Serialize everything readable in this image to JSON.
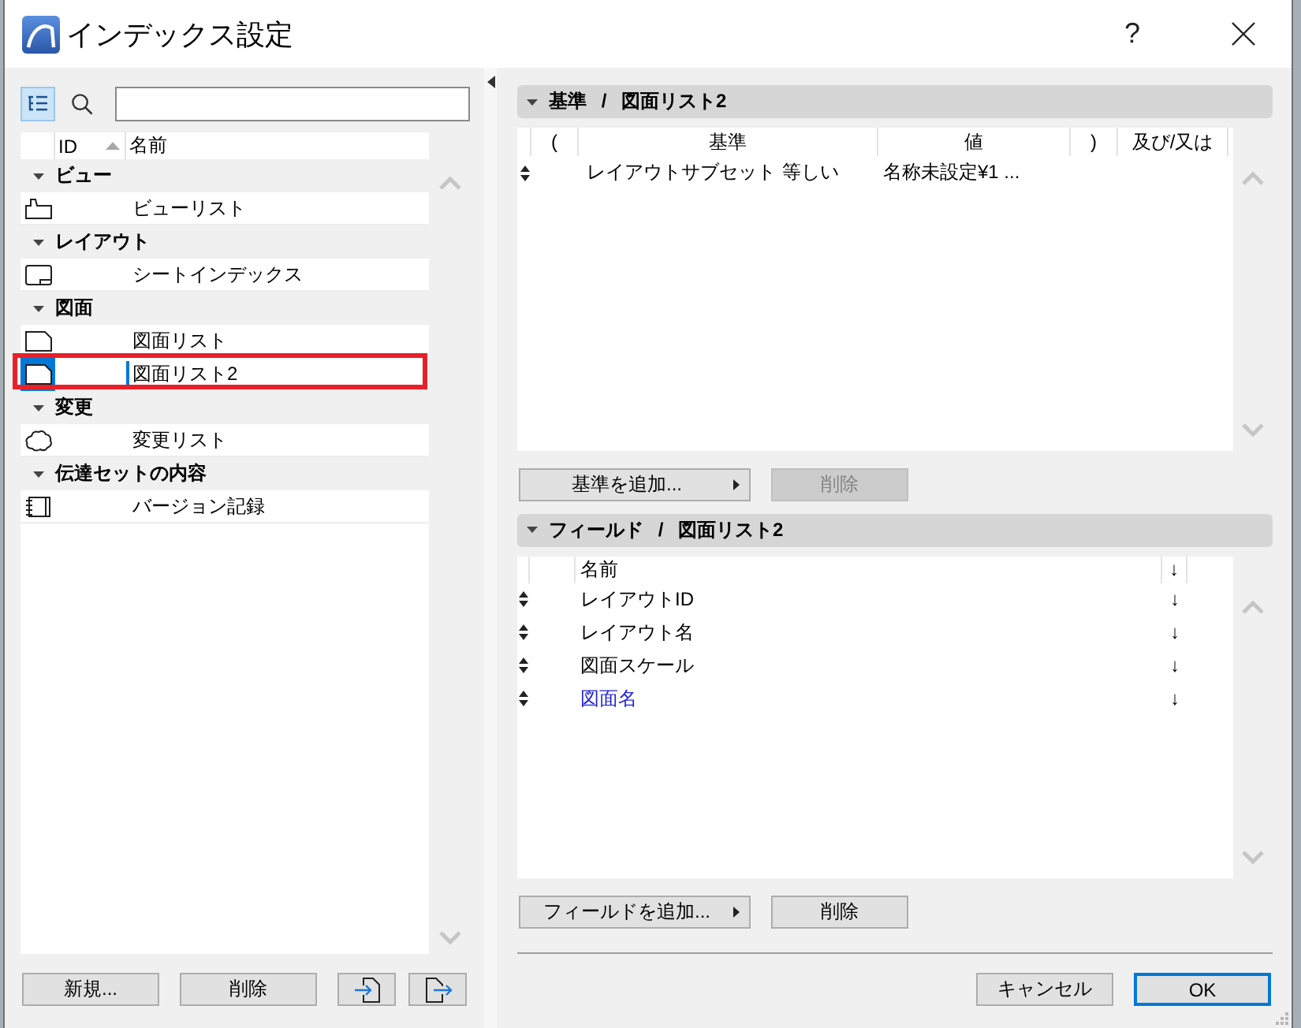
{
  "window": {
    "title": "インデックス設定",
    "help": "?"
  },
  "sidebar": {
    "list_view": {
      "selected": true
    },
    "columns": [
      {
        "label": "ID",
        "sorted": true
      },
      {
        "label": "名前",
        "sorted": false
      }
    ],
    "groups": [
      {
        "label": "ビュー",
        "expanded": true,
        "children": [
          {
            "name": "ビューリスト",
            "kind": "view",
            "selected": false,
            "marked": false
          }
        ]
      },
      {
        "label": "レイアウト",
        "expanded": true,
        "children": [
          {
            "name": "シートインデックス",
            "kind": "sheet",
            "selected": false,
            "marked": false
          }
        ]
      },
      {
        "label": "図面",
        "expanded": true,
        "children": [
          {
            "name": "図面リスト",
            "kind": "drawing",
            "selected": false,
            "marked": false
          },
          {
            "name": "図面リスト2",
            "kind": "drawing",
            "selected": true,
            "marked": true
          }
        ]
      },
      {
        "label": "変更",
        "expanded": true,
        "children": [
          {
            "name": "変更リスト",
            "kind": "change",
            "selected": false,
            "marked": false
          }
        ]
      },
      {
        "label": "伝達セットの内容",
        "expanded": true,
        "children": [
          {
            "name": "バージョン記録",
            "kind": "log",
            "selected": false,
            "marked": false
          }
        ]
      }
    ],
    "buttons": [
      {
        "kind": "text",
        "label": "新規..."
      },
      {
        "kind": "text",
        "label": "削除"
      },
      {
        "kind": "import"
      },
      {
        "kind": "export"
      }
    ]
  },
  "criteria": {
    "title": "基準 / 図面リスト2",
    "expanded": true,
    "columns": [
      "(",
      "基準",
      "値",
      ")",
      "及び/又は"
    ],
    "rows": [
      {
        "criterion": "レイアウトサブセット",
        "operator": "等しい",
        "value": "名称未設定¥1 ..."
      }
    ],
    "buttons": [
      {
        "kind": "menu",
        "label": "基準を追加...",
        "disabled": false
      },
      {
        "kind": "plain",
        "label": "削除",
        "disabled": true
      }
    ]
  },
  "fields": {
    "title": "フィールド / 図面リスト2",
    "expanded": true,
    "columns": [
      "名前",
      "↓"
    ],
    "rows": [
      {
        "name": "レイアウトID",
        "order": "↓",
        "selected": false
      },
      {
        "name": "レイアウト名",
        "order": "↓",
        "selected": false
      },
      {
        "name": "図面スケール",
        "order": "↓",
        "selected": false
      },
      {
        "name": "図面名",
        "order": "↓",
        "selected": true
      }
    ],
    "buttons": [
      {
        "kind": "menu",
        "label": "フィールドを追加...",
        "disabled": false
      },
      {
        "kind": "plain",
        "label": "削除",
        "disabled": false
      }
    ]
  },
  "footer": {
    "buttons": [
      {
        "label": "キャンセル",
        "default": false
      },
      {
        "label": "OK",
        "default": true
      }
    ]
  }
}
